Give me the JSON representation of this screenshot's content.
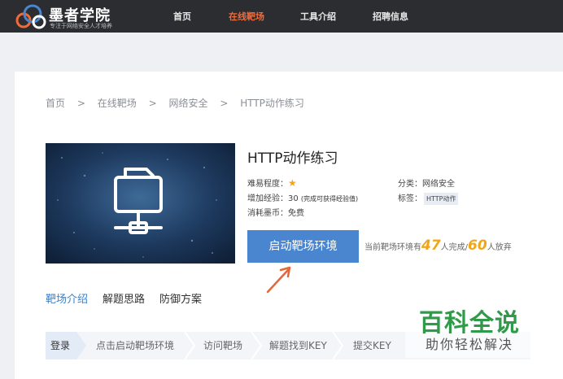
{
  "header": {
    "logo_name": "墨者学院",
    "logo_slogan": "专注于网络安全人才培养",
    "nav": [
      {
        "label": "首页",
        "active": false
      },
      {
        "label": "在线靶场",
        "active": true
      },
      {
        "label": "工具介绍",
        "active": false
      },
      {
        "label": "招聘信息",
        "active": false
      }
    ]
  },
  "breadcrumb": [
    "首页",
    "在线靶场",
    "网络安全",
    "HTTP动作练习"
  ],
  "breadcrumb_separator": ">",
  "lab": {
    "title": "HTTP动作练习",
    "difficulty_label": "难易程度：",
    "difficulty_star": "★",
    "difficulty_stars": 1,
    "exp_label": "增加经验：",
    "exp_value": "30",
    "exp_note": "(完成可获得经验值)",
    "cost_label": "消耗墨币：",
    "cost_value": "免费",
    "category_label": "分类：",
    "category_value": "网络安全",
    "tags_label": "标签：",
    "tag": "HTTP动作"
  },
  "start_button": "启动靶场环境",
  "env_stats": {
    "prefix": "当前靶场环境有",
    "completed": "47",
    "completed_suffix": "人完成/",
    "abandoned": "60",
    "abandoned_suffix": "人放弃"
  },
  "tabs": [
    {
      "label": "靶场介绍",
      "active": true
    },
    {
      "label": "解题思路",
      "active": false
    },
    {
      "label": "防御方案",
      "active": false
    }
  ],
  "steps": [
    "登录",
    "点击启动靶场环境",
    "访问靶场",
    "解题找到KEY",
    "提交KEY"
  ],
  "watermark": {
    "title": "百科全说",
    "subtitle": "助你轻松解决"
  },
  "colors": {
    "topbar": "#2b2d31",
    "nav_active": "#f06a3a",
    "primary_blue": "#4a86cf",
    "accent_orange": "#f3a51a",
    "tab_active": "#3a7fc9",
    "arrow": "#e2683a",
    "watermark_green": "#2f9a48"
  }
}
